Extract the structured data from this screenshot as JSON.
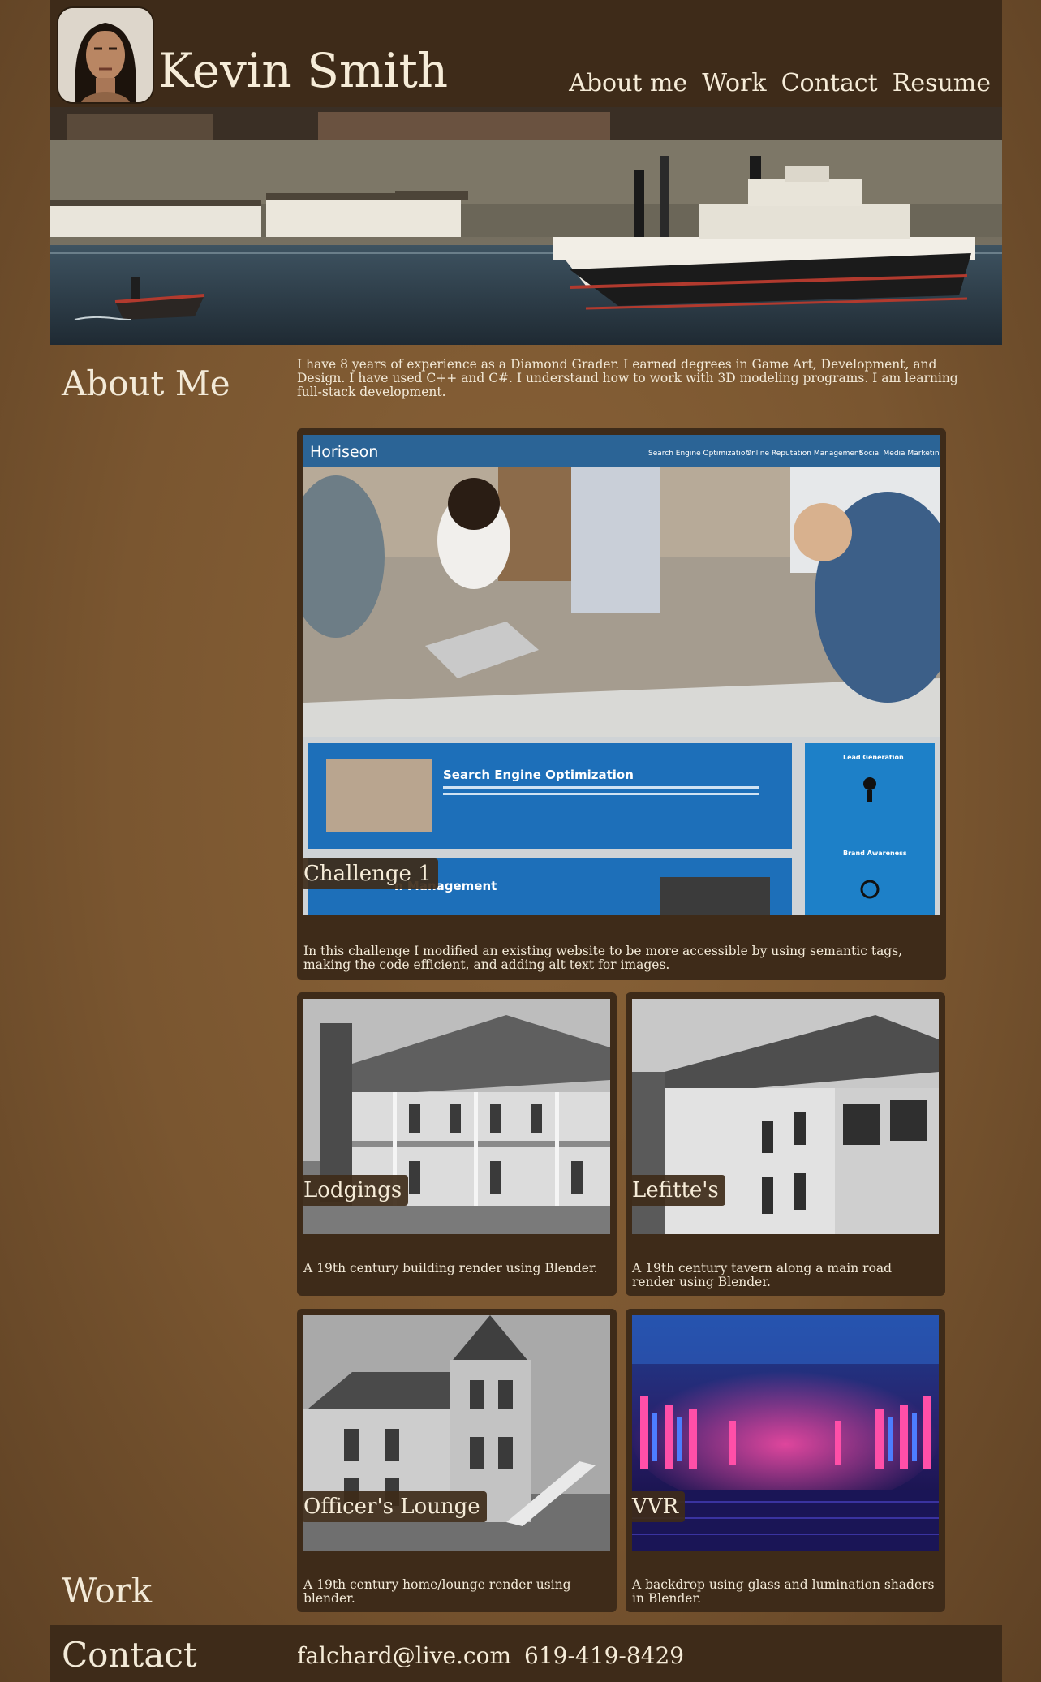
{
  "header": {
    "name": "Kevin Smith",
    "avatar_icon": "portrait-photo",
    "nav": [
      "About me",
      "Work",
      "Contact",
      "Resume"
    ]
  },
  "hero": {
    "image": "riverboat-painting"
  },
  "about": {
    "heading": "About Me",
    "text": "I have 8 years of experience as a Diamond Grader. I earned degrees in Game Art, Development, and Design. I have used C++ and C#. I understand how to work with 3D modeling programs. I am learning full-stack development."
  },
  "work": {
    "heading": "Work",
    "featured": {
      "title": "Challenge 1",
      "description": "In this challenge I modified an existing website to be more accessible by using semantic tags, making the code efficient, and adding alt text for images.",
      "screenshot": {
        "brand": "Horiseon",
        "nav": [
          "Search Engine Optimization",
          "Online Reputation Management",
          "Social Media Marketing"
        ],
        "panel1_title": "Search Engine Optimization",
        "panel2_title": "n Management",
        "side_title": "Lead Generation",
        "side_title2": "Brand Awareness"
      }
    },
    "projects": [
      {
        "title": "Lodgings",
        "description": "A 19th century building render using Blender."
      },
      {
        "title": "Lefitte's",
        "description": "A 19th century tavern along a main road render using Blender."
      },
      {
        "title": "Officer's Lounge",
        "description": "A 19th century home/lounge render using blender."
      },
      {
        "title": "VVR",
        "description": "A backdrop using glass and lumination shaders in Blender."
      }
    ]
  },
  "contact": {
    "heading": "Contact",
    "email": "falchard@live.com",
    "phone": "619-419-8429"
  },
  "colors": {
    "background": "#7a5630",
    "panel": "#3e2b19",
    "text": "#f3ead8"
  }
}
